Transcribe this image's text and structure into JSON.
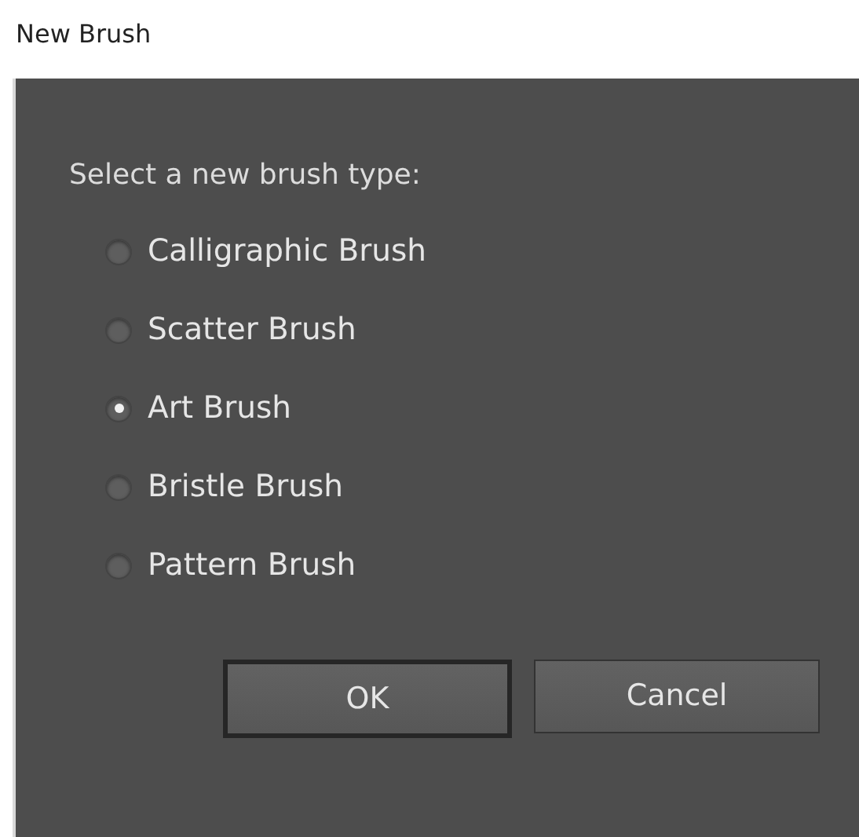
{
  "window": {
    "title": "New Brush"
  },
  "prompt": "Select a new brush type:",
  "options": [
    {
      "label": "Calligraphic Brush",
      "selected": false
    },
    {
      "label": "Scatter Brush",
      "selected": false
    },
    {
      "label": "Art Brush",
      "selected": true
    },
    {
      "label": "Bristle Brush",
      "selected": false
    },
    {
      "label": "Pattern Brush",
      "selected": false
    }
  ],
  "buttons": [
    {
      "label": "OK",
      "default": true
    },
    {
      "label": "Cancel",
      "default": false
    }
  ]
}
